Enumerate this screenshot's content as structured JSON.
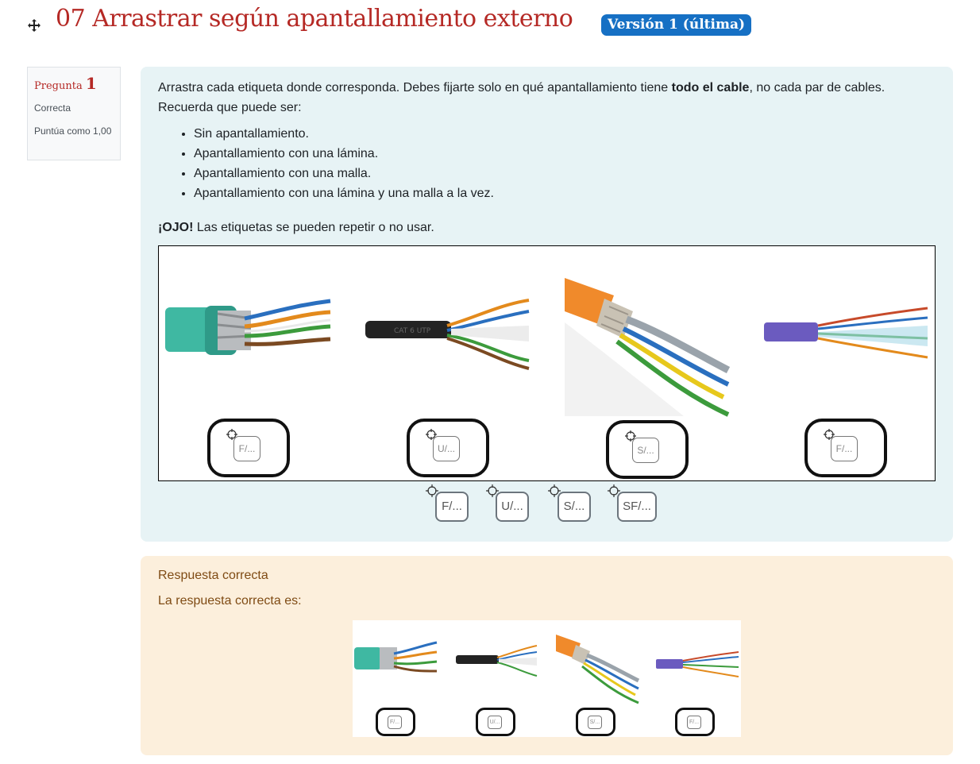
{
  "header": {
    "title": "07 Arrastrar según apantallamiento externo",
    "version_badge": "Versión 1 (última)"
  },
  "question_info": {
    "label": "Pregunta",
    "number": "1",
    "state": "Correcta",
    "grade": "Puntúa como 1,00"
  },
  "question": {
    "intro_before_bold": "Arrastra cada etiqueta donde corresponda. Debes fijarte solo en qué apantallamiento tiene ",
    "intro_bold": "todo el cable",
    "intro_after_bold": ", no cada par de cables.",
    "reminder": "Recuerda que puede ser:",
    "options": [
      "Sin apantallamiento.",
      "Apantallamiento con una lámina.",
      "Apantallamiento con una malla.",
      "Apantallamiento con una lámina y una malla a la vez."
    ],
    "warning_bold": "¡OJO!",
    "warning_text": " Las etiquetas se pueden repetir o no usar."
  },
  "drop_zones": [
    "F/...",
    "U/...",
    "S/...",
    "F/..."
  ],
  "drag_items": [
    "F/...",
    "U/...",
    "S/...",
    "SF/..."
  ],
  "outcome": {
    "feedback": "Respuesta correcta",
    "right_answer": "La respuesta correcta es:",
    "zones": [
      "F/...",
      "U/...",
      "S/...",
      "F/..."
    ]
  },
  "colors": {
    "title": "#b52925",
    "badge": "#1670c4",
    "formulation_bg": "#e7f3f5",
    "outcome_bg": "#fcefdc"
  },
  "icons": [
    "move-icon",
    "crosshair-icon"
  ]
}
